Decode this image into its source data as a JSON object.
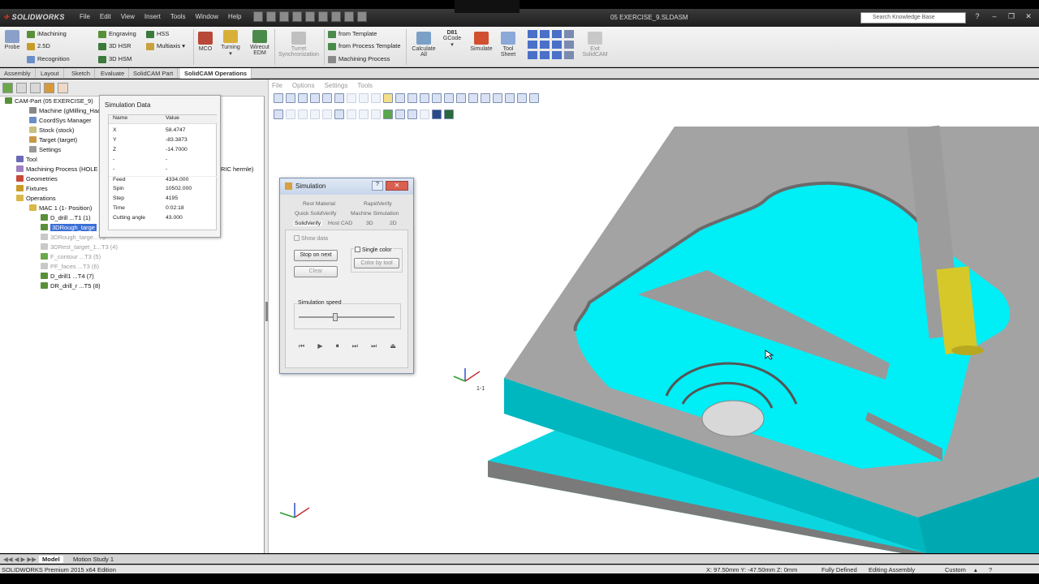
{
  "app": {
    "logo": "SOLIDWORKS",
    "document_title": "05 EXERCISE_9.SLDASM"
  },
  "menubar": [
    "File",
    "Edit",
    "View",
    "Insert",
    "Tools",
    "Window",
    "Help"
  ],
  "search": {
    "placeholder": "Search Knowledge Base"
  },
  "ribbon": {
    "probe": "Probe",
    "col1": [
      "iMachining",
      "2.5D",
      "Recognition"
    ],
    "col2": [
      "Engraving",
      "3D HSR",
      "3D HSM"
    ],
    "col3": [
      "HSS",
      "Multiaxis"
    ],
    "mco": "MCO",
    "turning": "Turning",
    "wirecut": "Wirecut EDM",
    "turret": "Turret Synchronization",
    "templates": [
      "from Template",
      "from Process Template",
      "Machining Process"
    ],
    "calculate": "Calculate All",
    "gcode": "GCode",
    "gcode_label": "D81",
    "simulate": "Simulate",
    "toolsheet": "Tool Sheet",
    "exit": "Exit SolidCAM"
  },
  "tabs": [
    "Assembly",
    "Layout",
    "Sketch",
    "Evaluate",
    "SolidCAM Part",
    "SolidCAM Operations"
  ],
  "tree": {
    "root": "CAM-Part (05 EXERCISE_9)",
    "machine": "Machine (gMilling_Haas",
    "coordsys": "CoordSys Manager",
    "stock": "Stock (stock)",
    "target": "Target (target)",
    "settings": "Settings",
    "tool": "Tool",
    "machining_process": "Machining Process (HOLE PR",
    "mp_suffix": "RIC hermle)",
    "geometries": "Geometries",
    "fixtures": "Fixtures",
    "operations": "Operations",
    "mac": "MAC 1 (1- Position)",
    "ops": [
      "D_drill ...T1 (1)",
      "3DRough_targe",
      "3DRough_targe...T3",
      "3DRest_target_1...T3 (4)",
      "F_contour ...T3 (5)",
      "PF_faces ...T3 (6)",
      "D_drill1 ...T4 (7)",
      "DR_drill_r ...T5 (8)"
    ]
  },
  "simdata": {
    "title": "Simulation Data",
    "headers": [
      "Name",
      "Value"
    ],
    "rows": [
      [
        "X",
        "58.4747"
      ],
      [
        "Y",
        "-83.3873"
      ],
      [
        "Z",
        "-14.7000"
      ],
      [
        "-",
        "-"
      ],
      [
        "-",
        "-"
      ],
      [
        "Feed",
        "4334.000"
      ],
      [
        "Spin",
        "10502.000"
      ],
      [
        "Step",
        "4195"
      ],
      [
        "Time",
        "0:02:18"
      ],
      [
        "Cutting angle",
        "43.000"
      ]
    ]
  },
  "viewport_menu": [
    "File",
    "Options",
    "Settings",
    "Tools"
  ],
  "simwin": {
    "title": "Simulation",
    "tabs_row1": [
      "Rest Material",
      "RapidVerify"
    ],
    "tabs_row2": [
      "Quick SolidVerify",
      "Machine Simulation"
    ],
    "tabs_row3": [
      "SolidVerify",
      "Host CAD",
      "3D",
      "2D"
    ],
    "show_data": "Show data",
    "stop_on_next": "Stop on next",
    "clear": "Clear",
    "single_color": "Single color",
    "color_by_tool": "Color by tool",
    "speed_label": "Simulation speed",
    "speed": 0.38
  },
  "status": {
    "model_tabs": [
      "Model",
      "Motion Study 1"
    ],
    "edition": "SOLIDWORKS Premium 2015 x64 Edition",
    "coords": "X: 97.50mm Y: -47.50mm Z: 0mm",
    "defined": "Fully Defined",
    "mode": "Editing Assembly",
    "units": "Custom"
  },
  "triad_label": "1-1",
  "colors": {
    "cyan": "#00e5ee",
    "gray": "#a9a9a9",
    "tool_yellow": "#d7c82a"
  }
}
